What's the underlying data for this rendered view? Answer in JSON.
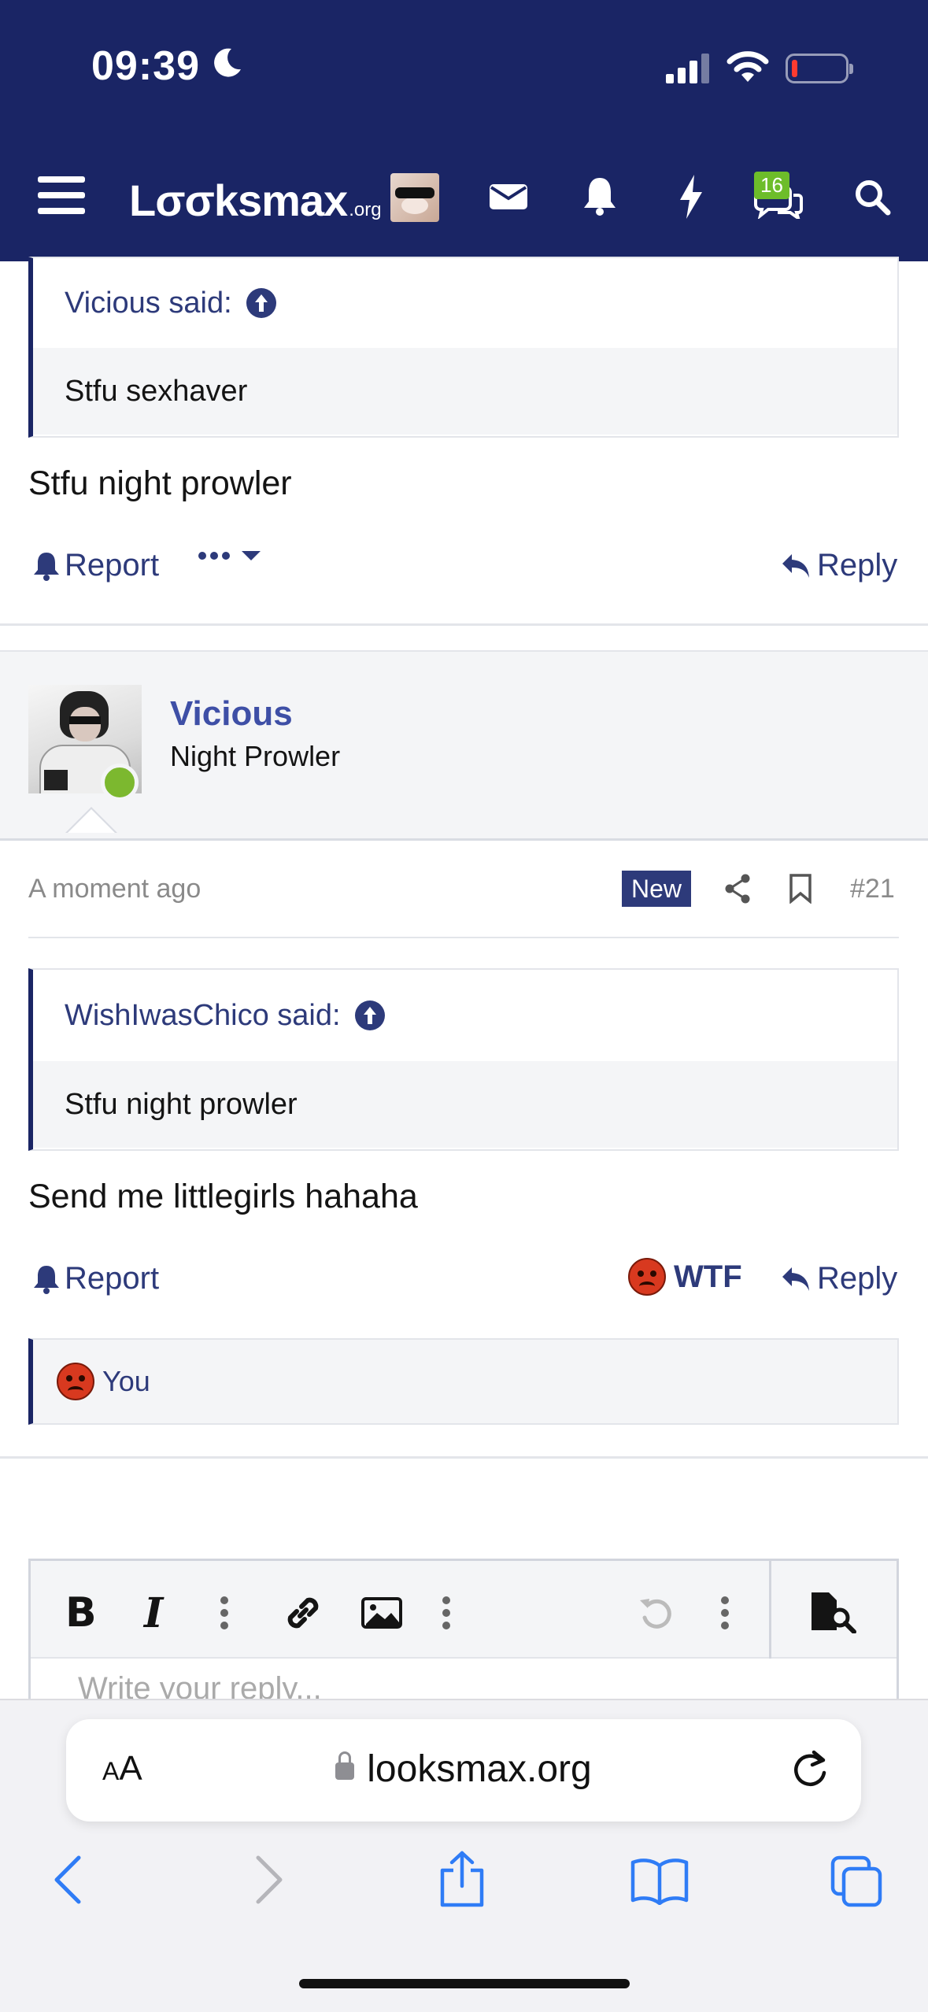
{
  "status_bar": {
    "time": "09:39"
  },
  "header": {
    "logo_main": "Lσσksmax",
    "logo_suffix": ".org",
    "conversations_badge": "16"
  },
  "post_prev": {
    "quote_author": "Vicious said:",
    "quote_text": "Stfu sexhaver",
    "body": "Stfu night prowler",
    "report_label": "Report",
    "reply_label": "Reply"
  },
  "post_21": {
    "username": "Vicious",
    "user_title": "Night Prowler",
    "time": "A moment ago",
    "new_badge": "New",
    "post_number": "#21",
    "quote_author": "WishIwasChico said:",
    "quote_text": "Stfu night prowler",
    "body": "Send me littlegirls hahaha",
    "report_label": "Report",
    "reaction_label": "WTF",
    "reply_label": "Reply",
    "reactions_summary": "You"
  },
  "editor": {
    "placeholder": "Write your reply..."
  },
  "safari": {
    "text_size": "AA",
    "url": "looksmax.org"
  },
  "colors": {
    "header_bg": "#1a2565",
    "accent": "#2d3a7a",
    "online": "#7cb82f",
    "badge_green": "#6dbd2a",
    "angry_red": "#d8391f"
  }
}
